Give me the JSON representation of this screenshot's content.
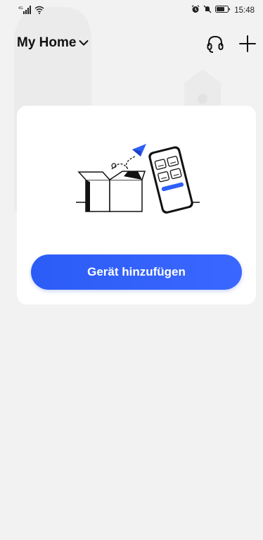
{
  "status_bar": {
    "network_label": "4G",
    "time": "15:48"
  },
  "header": {
    "home_name": "My Home"
  },
  "empty_card": {
    "add_button_label": "Gerät hinzufügen"
  },
  "colors": {
    "accent": "#2f5ff7",
    "background": "#f2f2f2",
    "card": "#ffffff"
  },
  "icons": [
    "signal-icon",
    "wifi-icon",
    "alarm-icon",
    "mute-icon",
    "battery-icon",
    "chevron-down-icon",
    "headset-icon",
    "plus-icon"
  ]
}
